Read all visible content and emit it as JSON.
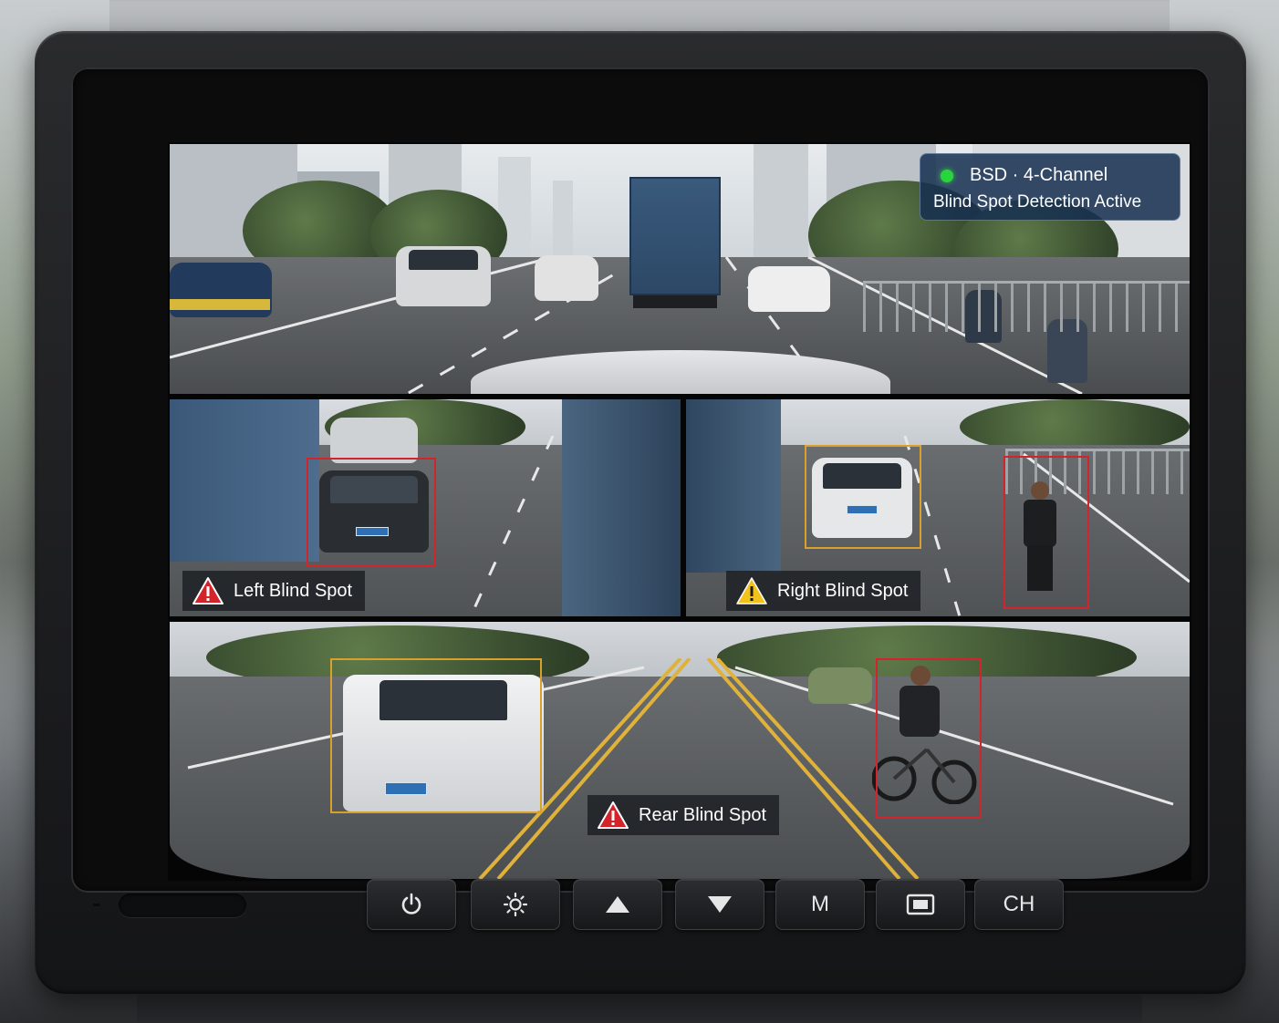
{
  "status_badge": {
    "line1": "BSD · 4-Channel",
    "line2": "Blind Spot Detection Active",
    "indicator_color": "#2ad43e"
  },
  "cameras": {
    "front": {
      "id": "front"
    },
    "left": {
      "warning_label": "Left Blind Spot",
      "warning_level": "danger",
      "warning_color": "#d2242a"
    },
    "right": {
      "warning_label": "Right Blind Spot",
      "warning_level": "caution",
      "warning_color": "#f2c21b"
    },
    "rear": {
      "warning_label": "Rear Blind Spot",
      "warning_level": "danger",
      "warning_color": "#d2242a"
    }
  },
  "detection_colors": {
    "danger": "#d2242a",
    "caution": "#d9a12a"
  },
  "controls": [
    {
      "name": "power-button",
      "icon": "power-icon",
      "label": ""
    },
    {
      "name": "brightness-button",
      "icon": "sun-icon",
      "label": ""
    },
    {
      "name": "up-button",
      "icon": "triangle-up-icon",
      "label": ""
    },
    {
      "name": "down-button",
      "icon": "triangle-down-icon",
      "label": ""
    },
    {
      "name": "menu-button",
      "icon": "",
      "label": "M"
    },
    {
      "name": "display-mode-button",
      "icon": "screen-icon",
      "label": ""
    },
    {
      "name": "channel-button",
      "icon": "",
      "label": "CH"
    }
  ]
}
